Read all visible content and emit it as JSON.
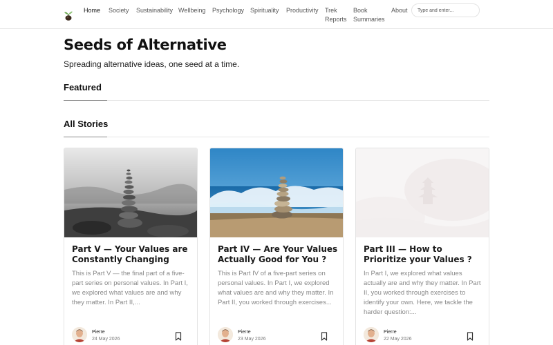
{
  "nav": {
    "logo_icon": "sprout-seed-icon",
    "items": [
      {
        "label": "Home",
        "active": true
      },
      {
        "label": "Society"
      },
      {
        "label": "Sustainability"
      },
      {
        "label": "Wellbeing"
      },
      {
        "label": "Psychology"
      },
      {
        "label": "Spirituality"
      },
      {
        "label": "Productivity"
      },
      {
        "label_line1": "Trek",
        "label_line2": "Reports"
      },
      {
        "label_line1": "Book",
        "label_line2": "Summaries"
      },
      {
        "label": "About"
      }
    ],
    "search": {
      "placeholder": "Type and enter...",
      "value": ""
    }
  },
  "header": {
    "title": "Seeds of Alternative",
    "tagline": "Spreading alternative ideas, one seed at a time."
  },
  "sections": {
    "featured": "Featured",
    "all_stories": "All Stories"
  },
  "stories": [
    {
      "title": "Part V — Your Values are Constantly Changing",
      "excerpt": "This is Part V — the final part of a five-part series on personal values. In Part I, we explored what values are and why they matter. In Part II,...",
      "author": "Pierre",
      "date": "24 May 2026",
      "image": "balanced-stones-black-white"
    },
    {
      "title": "Part IV — Are Your Values Actually Good for You ?",
      "excerpt": "This is Part IV of a five-part series on personal values. In Part I, we explored what values are and why they matter. In Part II, you worked through exercises...",
      "author": "Pierre",
      "date": "23 May 2026",
      "image": "stacked-stones-ocean-wave"
    },
    {
      "title": "Part III — How to Prioritize your Values ?",
      "excerpt": "In Part I, we explored what values actually are and why they matter. In Part II, you worked through exercises to identify your own. Here, we tackle the harder question:...",
      "author": "Pierre",
      "date": "22 May 2026",
      "image": "misty-temple-faded"
    }
  ],
  "colors": {
    "text": "#111111",
    "muted": "#888888",
    "border": "#e3e3e3"
  }
}
